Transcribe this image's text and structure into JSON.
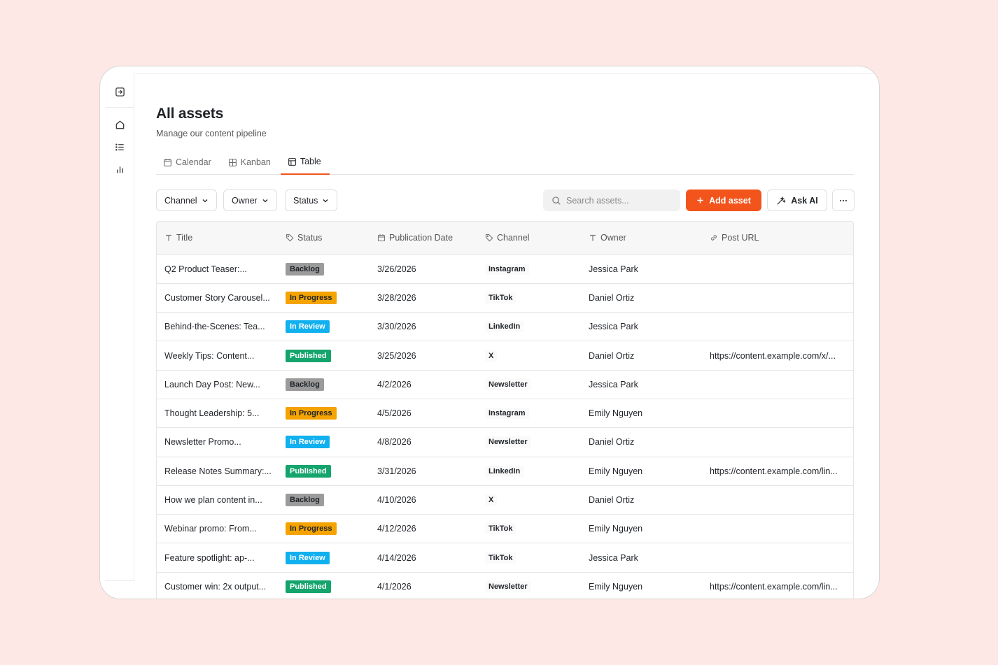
{
  "sidebar": {
    "items": [
      {
        "name": "collapse-icon"
      },
      {
        "name": "home-icon"
      },
      {
        "name": "list-icon"
      },
      {
        "name": "chart-icon"
      }
    ]
  },
  "header": {
    "title": "All assets",
    "subtitle": "Manage our content pipeline"
  },
  "tabs": [
    {
      "label": "Calendar",
      "icon": "calendar-icon",
      "active": false
    },
    {
      "label": "Kanban",
      "icon": "grid-icon",
      "active": false
    },
    {
      "label": "Table",
      "icon": "table-icon",
      "active": true
    }
  ],
  "filters": {
    "channel": "Channel",
    "owner": "Owner",
    "status": "Status"
  },
  "search": {
    "placeholder": "Search assets..."
  },
  "actions": {
    "add": "Add asset",
    "ask_ai": "Ask AI"
  },
  "colors": {
    "accent": "#f2541b",
    "backlog": "#9b9b9b",
    "in_progress": "#f5a300",
    "in_review": "#11b0ef",
    "published": "#14a46c"
  },
  "table": {
    "columns": [
      "Title",
      "Status",
      "Publication Date",
      "Channel",
      "Owner",
      "Post URL"
    ],
    "rows": [
      {
        "title": "Q2 Product Teaser:...",
        "status": "Backlog",
        "date": "3/26/2026",
        "channel": "Instagram",
        "owner": "Jessica Park",
        "url": ""
      },
      {
        "title": "Customer Story Carousel...",
        "status": "In Progress",
        "date": "3/28/2026",
        "channel": "TikTok",
        "owner": "Daniel Ortiz",
        "url": ""
      },
      {
        "title": "Behind-the-Scenes: Tea...",
        "status": "In Review",
        "date": "3/30/2026",
        "channel": "LinkedIn",
        "owner": "Jessica Park",
        "url": ""
      },
      {
        "title": "Weekly Tips: Content...",
        "status": "Published",
        "date": "3/25/2026",
        "channel": "X",
        "owner": "Daniel Ortiz",
        "url": "https://content.example.com/x/..."
      },
      {
        "title": "Launch Day Post: New...",
        "status": "Backlog",
        "date": "4/2/2026",
        "channel": "Newsletter",
        "owner": "Jessica Park",
        "url": ""
      },
      {
        "title": "Thought Leadership: 5...",
        "status": "In Progress",
        "date": "4/5/2026",
        "channel": "Instagram",
        "owner": "Emily Nguyen",
        "url": ""
      },
      {
        "title": "Newsletter Promo...",
        "status": "In Review",
        "date": "4/8/2026",
        "channel": "Newsletter",
        "owner": "Daniel Ortiz",
        "url": ""
      },
      {
        "title": "Release Notes Summary:...",
        "status": "Published",
        "date": "3/31/2026",
        "channel": "LinkedIn",
        "owner": "Emily Nguyen",
        "url": "https://content.example.com/lin..."
      },
      {
        "title": "How we plan content in...",
        "status": "Backlog",
        "date": "4/10/2026",
        "channel": "X",
        "owner": "Daniel Ortiz",
        "url": ""
      },
      {
        "title": "Webinar promo: From...",
        "status": "In Progress",
        "date": "4/12/2026",
        "channel": "TikTok",
        "owner": "Emily Nguyen",
        "url": ""
      },
      {
        "title": "Feature spotlight: ap-...",
        "status": "In Review",
        "date": "4/14/2026",
        "channel": "TikTok",
        "owner": "Jessica Park",
        "url": ""
      },
      {
        "title": "Customer win: 2x output...",
        "status": "Published",
        "date": "4/1/2026",
        "channel": "Newsletter",
        "owner": "Emily Nguyen",
        "url": "https://content.example.com/lin..."
      }
    ]
  }
}
